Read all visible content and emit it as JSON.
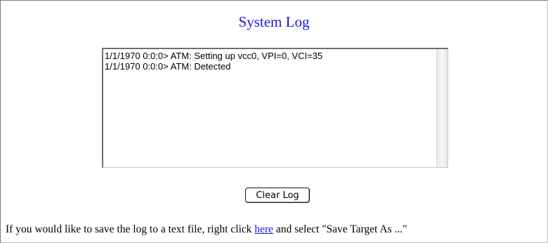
{
  "page": {
    "title": "System Log"
  },
  "log": {
    "lines": [
      "1/1/1970 0:0:0> ATM: Setting up vcc0, VPI=0, VCI=35",
      "1/1/1970 0:0:0> ATM: Detected"
    ]
  },
  "actions": {
    "clear_label": "Clear Log"
  },
  "footer": {
    "prefix": "If you would like to save the log to a text file, right click ",
    "link_text": "here",
    "suffix": " and select \"Save Target As ...\""
  },
  "colors": {
    "title": "#1a1adc",
    "link": "#1a1add"
  }
}
